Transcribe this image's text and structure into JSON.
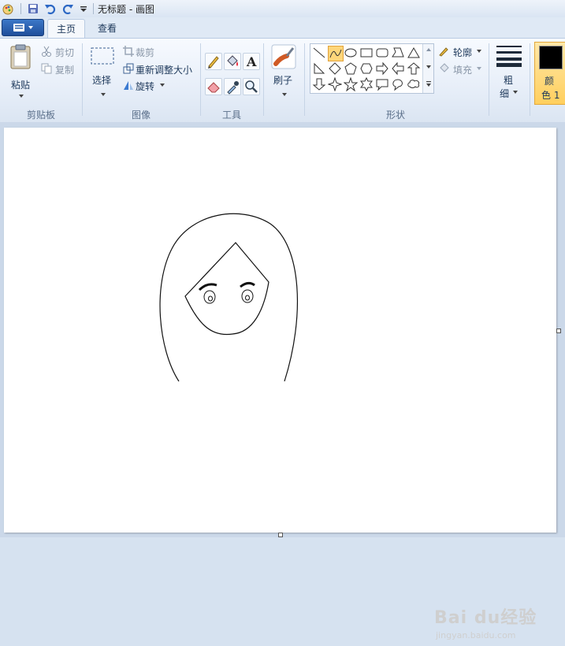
{
  "window": {
    "title": "无标题 - 画图"
  },
  "tabs": [
    {
      "label": "主页"
    },
    {
      "label": "查看"
    }
  ],
  "ribbon": {
    "clipboard": {
      "paste": "粘贴",
      "cut": "剪切",
      "copy": "复制",
      "group": "剪贴板"
    },
    "image": {
      "select": "选择",
      "crop": "裁剪",
      "resize": "重新调整大小",
      "rotate": "旋转",
      "group": "图像"
    },
    "tools": {
      "group": "工具"
    },
    "brushes": {
      "label": "刷子"
    },
    "shapes": {
      "outline": "轮廓",
      "fill": "填充",
      "group": "形状"
    },
    "size": {
      "label_1": "粗",
      "label_2": "细"
    },
    "color1": {
      "label_1": "颜",
      "label_2": "色 1",
      "value": "#000000"
    }
  },
  "watermark": {
    "brand": "Bai du经验",
    "url": "jingyan.baidu.com"
  },
  "colors": {
    "accent": "#ffcf5e",
    "app_button": "#1f4e9a"
  }
}
